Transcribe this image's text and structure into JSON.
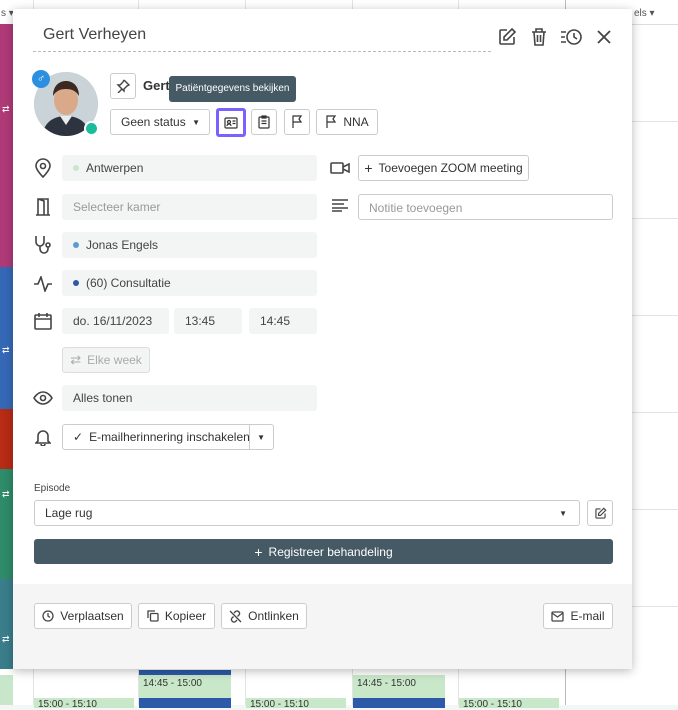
{
  "calendar": {
    "header_left": "s ▾",
    "header_right": "els ▾",
    "events": [
      {
        "time": "14:45 - 15:00"
      },
      {
        "time": "14:45 - 15:00"
      },
      {
        "time": "15:00 - 15:10"
      },
      {
        "time": "15:00 - 15:10"
      },
      {
        "time": "15:00 - 15:10"
      },
      {
        "time": "15:00 - 15:10"
      }
    ]
  },
  "dialog": {
    "title": "Gert Verheyen",
    "patient_name_short": "Gert",
    "tooltip": "Patiëntgegevens bekijken",
    "status": "Geen status",
    "nna_label": "NNA",
    "location": "Antwerpen",
    "room_placeholder": "Selecteer kamer",
    "practitioner": "Jonas Engels",
    "appointment_type": "(60) Consultatie",
    "date": "do. 16/11/2023",
    "start_time": "13:45",
    "end_time": "14:45",
    "repeat_label": "Elke week",
    "visibility": "Alles tonen",
    "email_reminder": "E-mailherinnering inschakelen",
    "zoom_label": "Toevoegen ZOOM meeting",
    "note_placeholder": "Notitie toevoegen",
    "episode_label": "Episode",
    "episode_value": "Lage rug",
    "register_label": "Registreer behandeling",
    "footer": {
      "move": "Verplaatsen",
      "copy": "Kopieer",
      "unlink": "Ontlinken",
      "email": "E-mail"
    },
    "colors": {
      "dark_button": "#455a64",
      "accent_purple": "#7b61ff",
      "online_green": "#1abc9c",
      "gender_blue": "#2d8fe0"
    }
  }
}
